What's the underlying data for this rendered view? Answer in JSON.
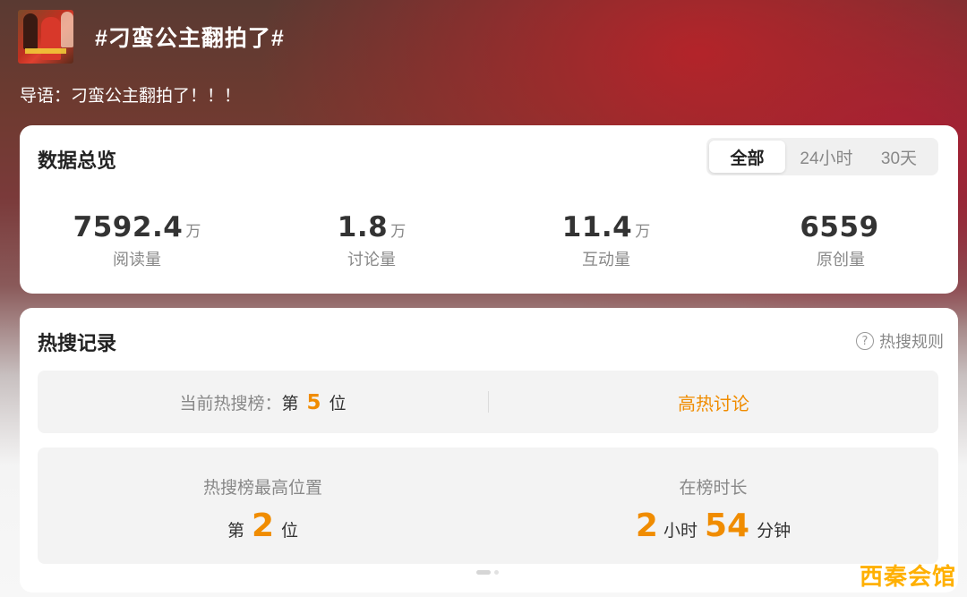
{
  "topic": {
    "title": "#刁蛮公主翻拍了#",
    "lead_label": "导语：",
    "lead_text": "刁蛮公主翻拍了！！！"
  },
  "overview": {
    "title": "数据总览",
    "tabs": [
      "全部",
      "24小时",
      "30天"
    ],
    "selected_tab": "全部",
    "stats": [
      {
        "value": "7592.4",
        "unit": "万",
        "label": "阅读量"
      },
      {
        "value": "1.8",
        "unit": "万",
        "label": "讨论量"
      },
      {
        "value": "11.4",
        "unit": "万",
        "label": "互动量"
      },
      {
        "value": "6559",
        "unit": "",
        "label": "原创量"
      }
    ]
  },
  "hot_search": {
    "title": "热搜记录",
    "rules_label": "热搜规则",
    "current_rank_label": "当前热搜榜：",
    "rank_prefix": "第",
    "current_rank": "5",
    "rank_suffix": "位",
    "heat_tag": "高热讨论",
    "best_position_label": "热搜榜最高位置",
    "best_rank": "2",
    "duration_label": "在榜时长",
    "duration_hours": "2",
    "hours_unit": "小时",
    "duration_minutes": "54",
    "minutes_unit": "分钟"
  },
  "watermark": "西秦会馆",
  "colors": {
    "accent": "#f08c00",
    "card_bg": "#ffffff",
    "inner_box_bg": "#f3f3f3"
  },
  "icons": {
    "rules": "help-circle-icon"
  }
}
